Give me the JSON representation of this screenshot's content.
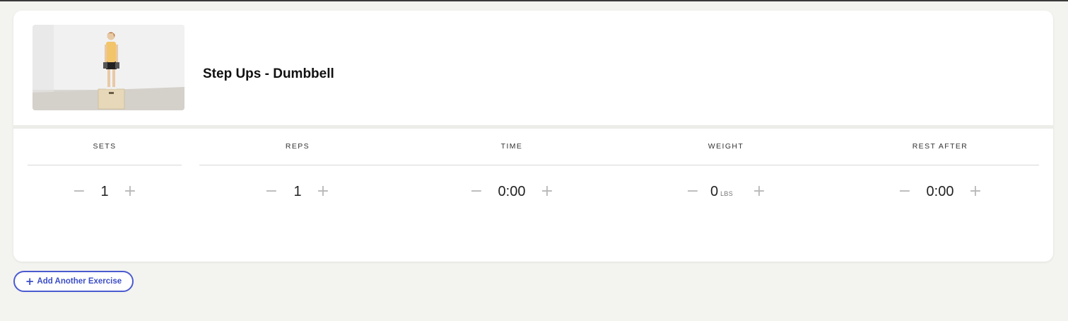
{
  "exercise": {
    "title": "Step Ups - Dumbbell"
  },
  "fields": {
    "sets": {
      "label": "SETS",
      "value": "1"
    },
    "reps": {
      "label": "REPS",
      "value": "1"
    },
    "time": {
      "label": "TIME",
      "value": "0:00"
    },
    "weight": {
      "label": "WEIGHT",
      "value": "0",
      "unit": "LBS"
    },
    "rest": {
      "label": "REST AFTER",
      "value": "0:00"
    }
  },
  "stepper": {
    "minus": "−",
    "plus": "+"
  },
  "actions": {
    "add_exercise_icon": "+",
    "add_exercise_label": "Add Another Exercise"
  },
  "colors": {
    "background": "#f3f3ef",
    "card": "#ffffff",
    "accent": "#4b5bd0",
    "stepper_icon": "#b8b8b8"
  },
  "icons": {
    "minus": "minus-icon",
    "plus": "plus-icon"
  }
}
